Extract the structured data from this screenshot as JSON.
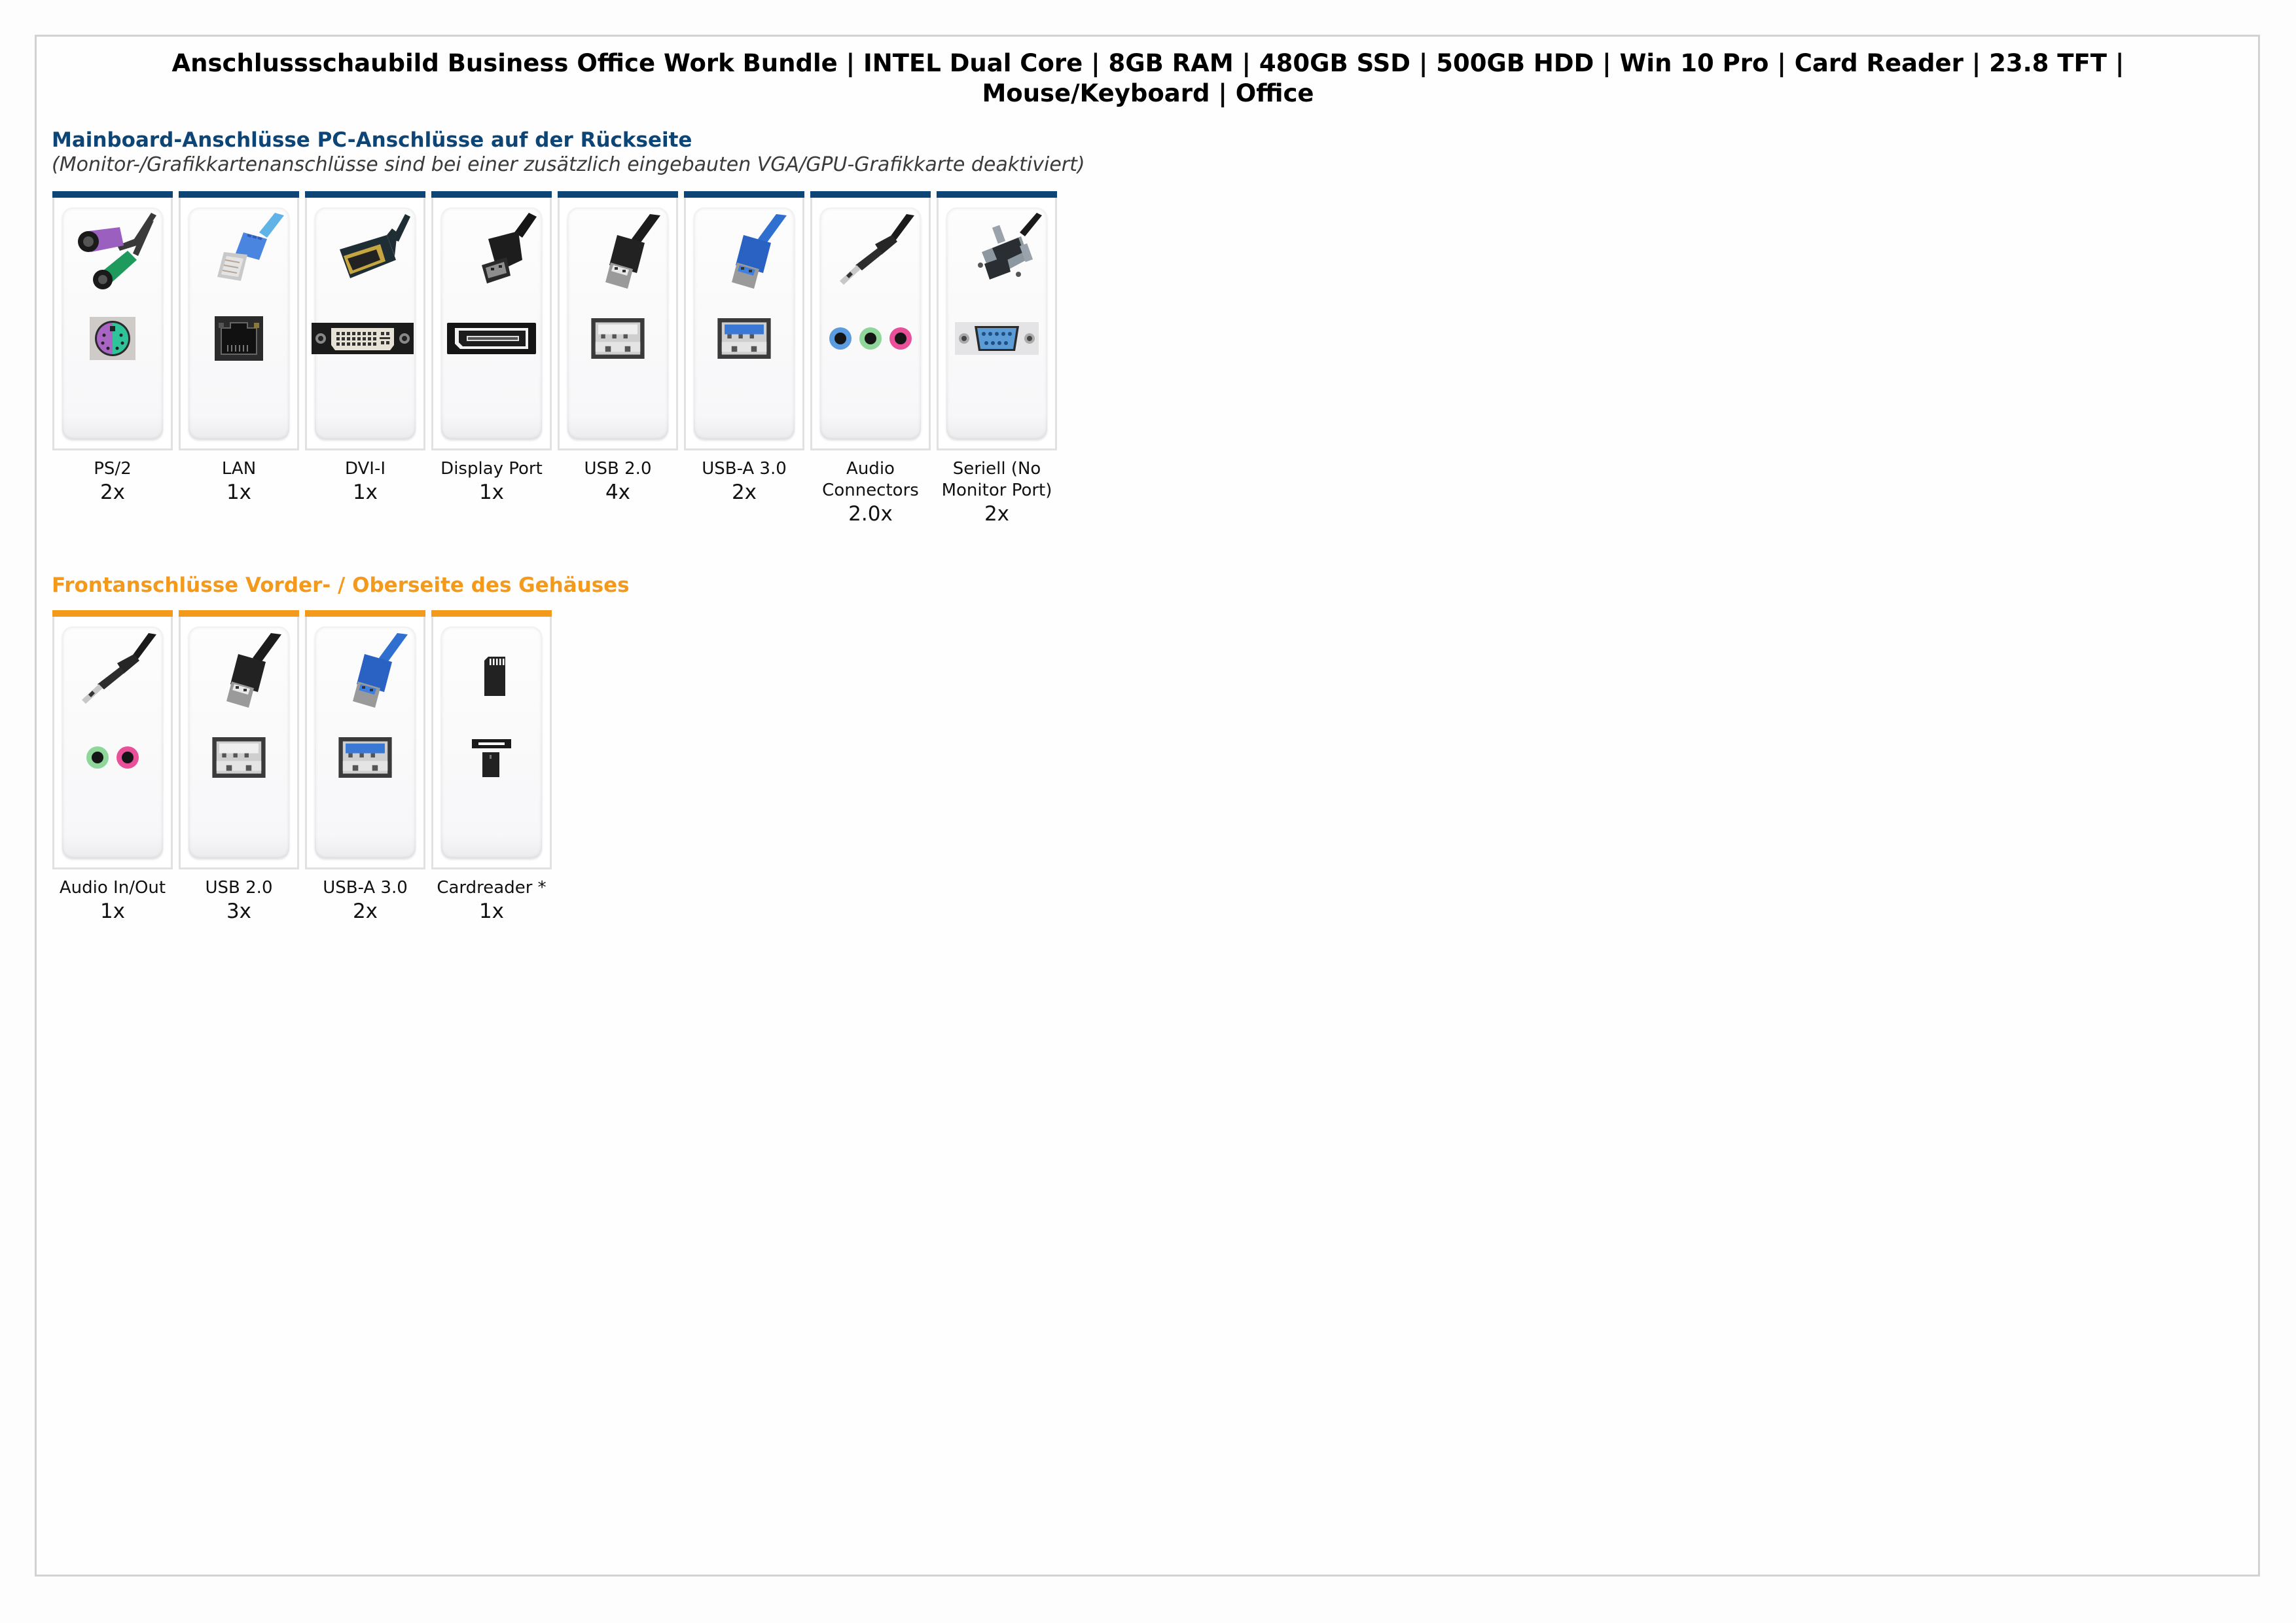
{
  "title": "Anschlussschaubild Business Office Work Bundle | INTEL Dual Core | 8GB RAM | 480GB SSD | 500GB HDD | Win 10 Pro | Card Reader | 23.8 TFT | Mouse/Keyboard | Office",
  "colors": {
    "back_accent": "#0d4676",
    "front_accent": "#f39a1d",
    "frame_border": "#d2d2d4"
  },
  "back": {
    "heading": "Mainboard-Anschlüsse PC-Anschlüsse auf der Rückseite",
    "note": "(Monitor-/Grafikkartenanschlüsse sind bei einer zusätzlich eingebauten VGA/GPU-Grafikkarte deaktiviert)",
    "ports": [
      {
        "label": "PS/2",
        "count": "2x",
        "icon": "ps2-connector-icon"
      },
      {
        "label": "LAN",
        "count": "1x",
        "icon": "lan-connector-icon"
      },
      {
        "label": "DVI-I",
        "count": "1x",
        "icon": "dvi-connector-icon"
      },
      {
        "label": "Display Port",
        "count": "1x",
        "icon": "displayport-connector-icon"
      },
      {
        "label": "USB 2.0",
        "count": "4x",
        "icon": "usb2-connector-icon"
      },
      {
        "label": "USB-A 3.0",
        "count": "2x",
        "icon": "usb3-connector-icon"
      },
      {
        "label": "Audio Connectors",
        "count": "2.0x",
        "icon": "audio-connector-icon"
      },
      {
        "label": "Seriell (No Monitor Port)",
        "count": "2x",
        "icon": "serial-connector-icon"
      }
    ]
  },
  "front": {
    "heading": "Frontanschlüsse Vorder- / Oberseite des Gehäuses",
    "ports": [
      {
        "label": "Audio In/Out",
        "count": "1x",
        "icon": "audio-connector-icon"
      },
      {
        "label": "USB 2.0",
        "count": "3x",
        "icon": "usb2-connector-icon"
      },
      {
        "label": "USB-A 3.0",
        "count": "2x",
        "icon": "usb3-connector-icon"
      },
      {
        "label": "Cardreader *",
        "count": "1x",
        "icon": "cardreader-icon"
      }
    ]
  }
}
